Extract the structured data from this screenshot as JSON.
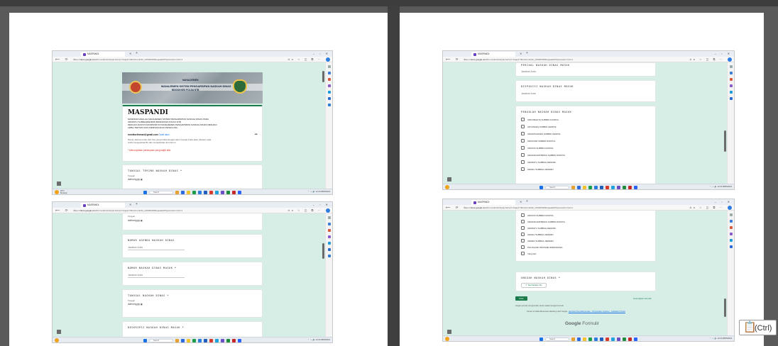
{
  "browser": {
    "tab_title": "MASPANDI",
    "url_prefix": "https://",
    "url_host": "docs.google.com",
    "url_rest": "/forms/d/e/1FAIpQLSeOpYxSqaqTVMCdUsn3hRi_U0MMXR8ReqiaeEdPGj/viewform?pli=1",
    "window_controls": "– ▫ ✕",
    "nav_icons": "⟵ ⟳ ⌂",
    "nav_right_icons": "Aa ☆ ◫ ⧉ ⋯",
    "tab_close": "✕",
    "tab_new": "+"
  },
  "taskbar": {
    "weather_temp": "28°C",
    "weather_desc": "Berawan",
    "search_label": "Search",
    "time": "12:20",
    "date": "08/05/2024",
    "tray_icons": "⌃ ◔ ⌁ 🔊"
  },
  "banner": {
    "line1": "MANAJEMEN",
    "line2": "MANAJEMEN SISTEM PENGARSIPAN NASKAH DINAS",
    "line3": "BIDDOKKES POLDA NTB"
  },
  "form": {
    "title": "MASPANDI",
    "desc1": "MASPANDI ADALAH MANAJEMEN SISTEM PENGARSIPAN NASKAH DINAS PADA",
    "desc2": "URMINTU SUBBAGRENMIN BIDDOKKES POLDA NTB",
    "desc3": "DENGAN ADANYA MASPANDI INI MANAJEMEN PENGARSIPAN NASKAH DINAS MENJADI",
    "desc4": "LEBIH TERTATA DAN MEMUDAHKAN PENGGUNA.",
    "email": "monikorthewari@gmail.com",
    "switch_account": "Ganti akun",
    "not_shared": "Nama, alamat email, dan foto yang terkait dengan akun Google Anda akan direkam saat",
    "not_shared2": "Anda mengupload file dan mengirimkan formulir ini",
    "required_note": "* Menunjukkan pertanyaan yang wajib diisi",
    "q_tanggal": "TANGGAL TERIMA NASKAH DINAS *",
    "q_tanggal_nodash": "TANGGAL TERIMA NASKAH DINAS",
    "date_label": "Tanggal",
    "date_value": "dd/mm/yyyy",
    "q_nomor_agenda": "NOMOR AGENDA NASKAH DINAS",
    "q_nomor_naskah": "NOMOR NASKAH DINAS MASUK *",
    "q_tanggal_naskah": "TANGGAL NASKAH DINAS *",
    "q_perihal": "PERIHAL NASKAH DINAS MASUK",
    "q_disposisi": "DISPOSISI NASKAH DINAS MASUK",
    "q_pengolah": "PENGOLAH NASKAH DINAS MASUK",
    "q_deskripsi": "DESKRIPSI NASKAH DINAS MASUK *",
    "q_unggah": "UNGGAH NASKAH DINAS *",
    "answer_placeholder": "Jawaban Anda",
    "upload_button": "Tambahkan file",
    "submit": "Kirim",
    "clear": "Kosongkan formulir",
    "footer1": "Jangan pernah mengirimkan sandi melalui Google Formulir.",
    "footer2": "Konten ini tidak dibuat atau didukung oleh Google.",
    "footer_links": "Laporkan Penyalahgunaan - Persyaratan Layanan - Kebijakan Privasi",
    "gforms_google": "Google",
    "gforms_formulir": "Formulir",
    "options_a": [
      "URKOMAHTA SUBBID KOOPOL",
      "URYANKES SUBBID KESPOL",
      "URMATFASKES SUBBID KESPOL",
      "URDOKIM SUBBID DOKPOL",
      "URDOKI SUBBID DOKPOL",
      "URKESKAMTIBMAS SUBBID DOKPOL",
      "URMINTU SUBBAG RENMIN",
      "URKEU SUBBAG RENMIN"
    ],
    "options_b": [
      "URDOKI SUBBID DOKPOL",
      "URKESKAMTIBMAS SUBBID DOKPOL",
      "URMINTU SUBBAG RENMIN",
      "URKEU SUBBAG RENMIN",
      "URREN SUBBAG RENMIN",
      "POLIKLINIK PRATAMA BIDDOKKES",
      "Yang lain:"
    ]
  },
  "clipboard": {
    "icon": "📋",
    "label": "(Ctrl)"
  },
  "colors": {
    "form_bg": "#d7eee7",
    "accent_green": "#1c7b4c",
    "required_red": "#d93025"
  }
}
